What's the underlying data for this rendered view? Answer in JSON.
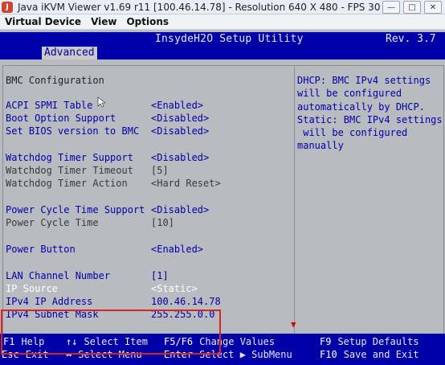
{
  "window": {
    "title": "Java iKVM Viewer v1.69 r11 [100.46.14.78]  - Resolution 640 X 480 - FPS 30",
    "controls": [
      "—",
      "□",
      "✕"
    ]
  },
  "menubar": {
    "items": [
      "Virtual Device",
      "View",
      "Options"
    ]
  },
  "bios": {
    "title": "InsydeH2O Setup Utility",
    "revision": "Rev. 3.7",
    "active_tab": "Advanced",
    "heading": "BMC Configuration",
    "items": [
      {
        "label": "ACPI SPMI Table",
        "value": "<Enabled>"
      },
      {
        "label": "Boot Option Support",
        "value": "<Disabled>"
      },
      {
        "label": "Set BIOS version to BMC",
        "value": "<Disabled>"
      },
      {
        "label": "Watchdog Timer Support",
        "value": "<Disabled>"
      },
      {
        "label": "Watchdog Timer Timeout",
        "value": "[5]"
      },
      {
        "label": "Watchdog Timer Action",
        "value": "<Hard Reset>"
      },
      {
        "label": "Power Cycle Time Support",
        "value": "<Disabled>"
      },
      {
        "label": "Power Cycle Time",
        "value": "[10]"
      },
      {
        "label": "Power Button",
        "value": "<Enabled>"
      },
      {
        "label": "LAN Channel Number",
        "value": "[1]"
      },
      {
        "label": "IP Source",
        "value": "<Static>"
      },
      {
        "label": "IPv4 IP Address",
        "value": "100.46.14.78"
      },
      {
        "label": "IPv4 Subnet Mask",
        "value": "255.255.0.0"
      }
    ],
    "help_text": "DHCP: BMC IPv4 settings\nwill be configured\nautomatically by DHCP.\nStatic: BMC IPv4 settings\n will be configured\nmanually",
    "keys": [
      {
        "key": "F1",
        "desc": "Help"
      },
      {
        "key": "↑↓",
        "desc": "Select Item"
      },
      {
        "key": "F5/F6",
        "desc": "Change Values"
      },
      {
        "key": "F9",
        "desc": "Setup Defaults"
      },
      {
        "key": "Esc",
        "desc": "Exit"
      },
      {
        "key": "↔",
        "desc": "Select Menu"
      },
      {
        "key": "Enter",
        "desc": "Select ▶ SubMenu"
      },
      {
        "key": "F10",
        "desc": "Save and Exit"
      }
    ],
    "colors": {
      "bios_blue": "#0000a8",
      "bios_gray": "#b8bbbf",
      "highlight_box": "#dd2222"
    }
  }
}
